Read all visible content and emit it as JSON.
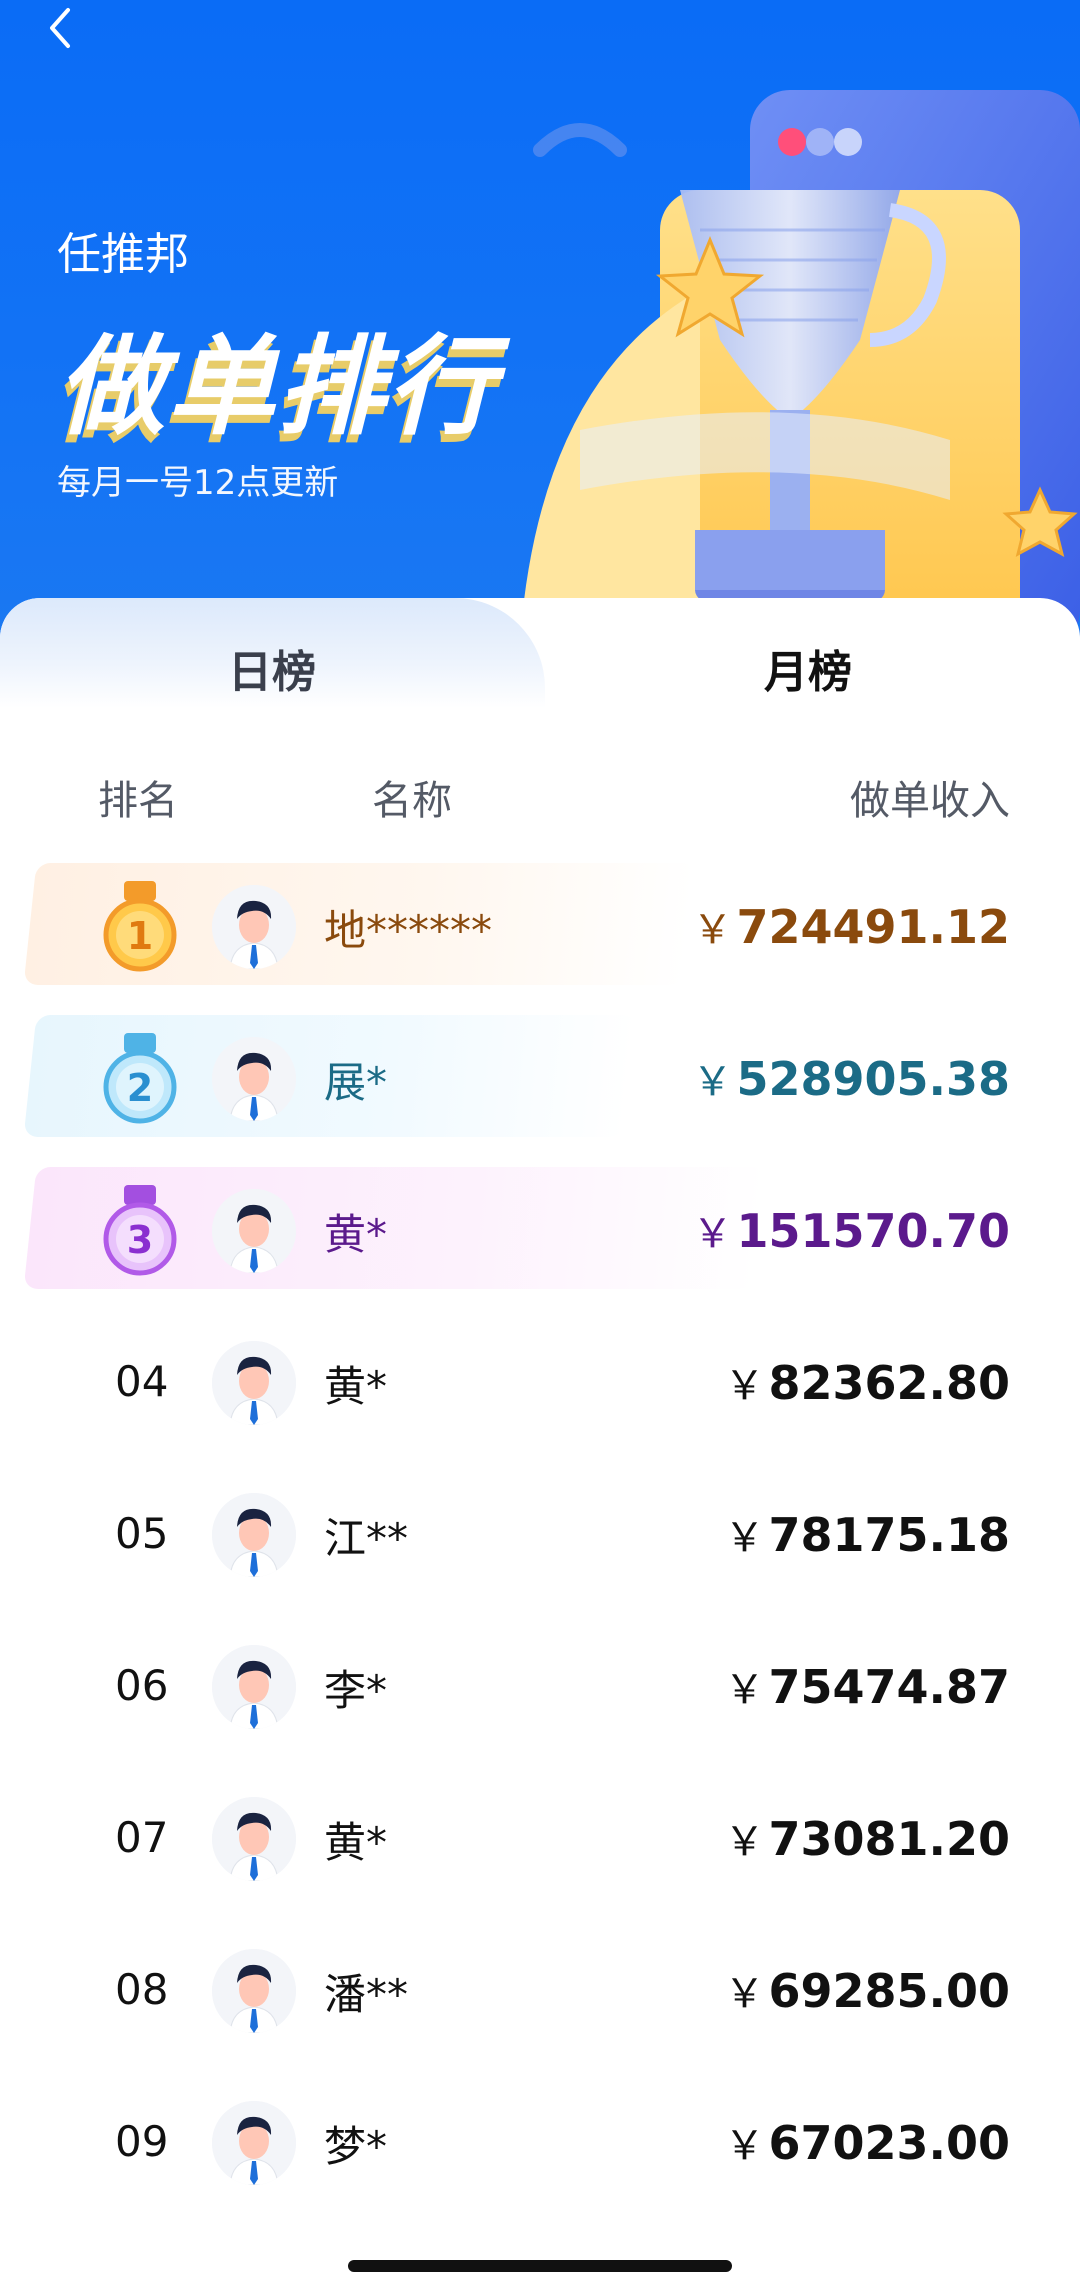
{
  "header": {
    "brand": "任推邦",
    "title": "做单排行",
    "subtitle": "每月一号12点更新"
  },
  "tabs": [
    {
      "label": "日榜",
      "active": false
    },
    {
      "label": "月榜",
      "active": true
    }
  ],
  "columns": {
    "rank": "排名",
    "name": "名称",
    "income": "做单收入"
  },
  "currency_symbol": "￥",
  "colors": {
    "brand_blue": "#0a6cf6",
    "gold": "#8a4a0d",
    "silver_teal": "#1b6b86",
    "bronze_purple": "#5b1a8c"
  },
  "rows": [
    {
      "rank": "1",
      "name": "地******",
      "income": "724491.12",
      "medal": "gold-medal-icon"
    },
    {
      "rank": "2",
      "name": "展*",
      "income": "528905.38",
      "medal": "silver-medal-icon"
    },
    {
      "rank": "3",
      "name": "黄*",
      "income": "151570.70",
      "medal": "bronze-medal-icon"
    },
    {
      "rank": "04",
      "name": "黄*",
      "income": "82362.80"
    },
    {
      "rank": "05",
      "name": "江**",
      "income": "78175.18"
    },
    {
      "rank": "06",
      "name": "李*",
      "income": "75474.87"
    },
    {
      "rank": "07",
      "name": "黄*",
      "income": "73081.20"
    },
    {
      "rank": "08",
      "name": "潘**",
      "income": "69285.00"
    },
    {
      "rank": "09",
      "name": "梦*",
      "income": "67023.00"
    }
  ]
}
